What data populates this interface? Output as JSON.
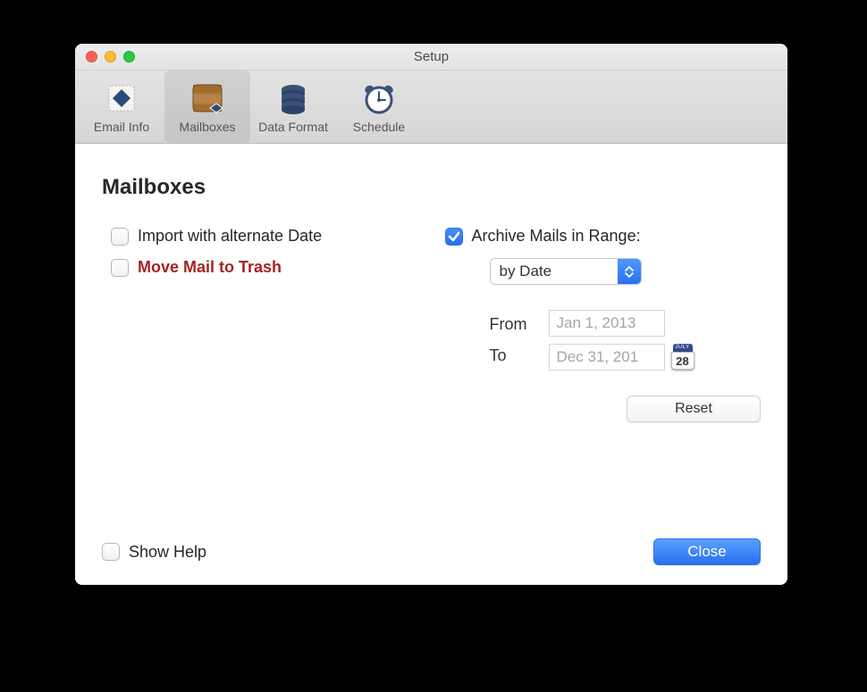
{
  "window": {
    "title": "Setup"
  },
  "toolbar": {
    "items": [
      {
        "id": "email-info",
        "label": "Email Info",
        "selected": false
      },
      {
        "id": "mailboxes",
        "label": "Mailboxes",
        "selected": true
      },
      {
        "id": "data-format",
        "label": "Data Format",
        "selected": false
      },
      {
        "id": "schedule",
        "label": "Schedule",
        "selected": false
      }
    ]
  },
  "page": {
    "title": "Mailboxes"
  },
  "options": {
    "import_alternate_date": {
      "label": "Import with alternate Date",
      "checked": false
    },
    "move_to_trash": {
      "label": "Move Mail to Trash",
      "checked": false
    },
    "archive_range": {
      "label": "Archive Mails in Range:",
      "checked": true
    }
  },
  "range": {
    "mode_select": {
      "value": "by Date"
    },
    "from_label": "From",
    "to_label": "To",
    "from_value": "Jan 1, 2013",
    "to_value": "Dec 31, 201",
    "reset_label": "Reset"
  },
  "calendar_icon": {
    "month": "JULY",
    "day": "28"
  },
  "footer": {
    "show_help": {
      "label": "Show Help",
      "checked": false
    },
    "close_label": "Close"
  }
}
